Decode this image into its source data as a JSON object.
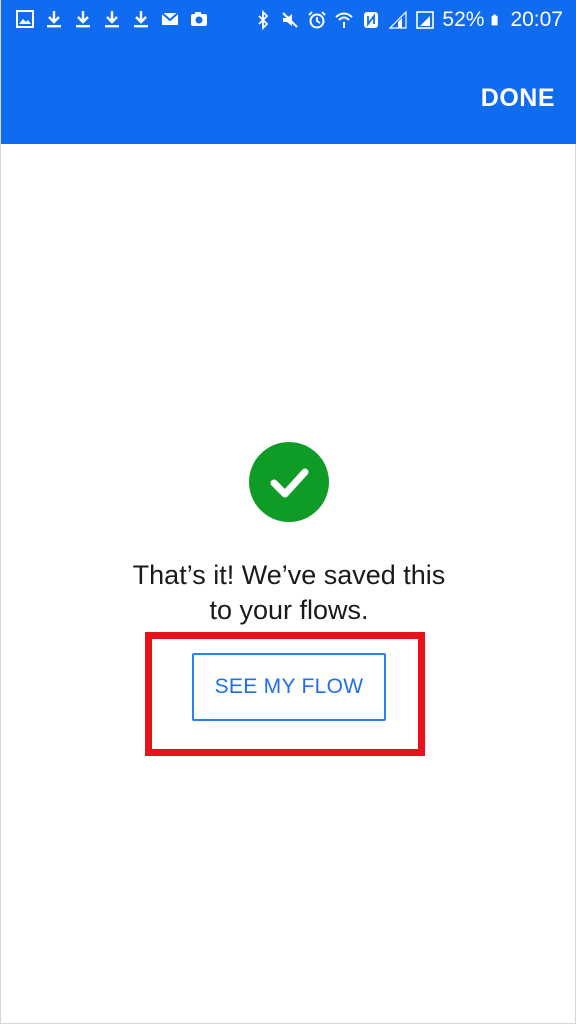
{
  "status_bar": {
    "left_icons": [
      "image-icon",
      "download-icon",
      "download-icon",
      "download-icon",
      "download-icon",
      "email-icon",
      "photo-icon"
    ],
    "right_icons": [
      "bluetooth-icon",
      "mute-icon",
      "alarm-icon",
      "wifi-icon",
      "nfc-icon",
      "signal-icon",
      "signal-icon"
    ],
    "battery": "52%",
    "time": "20:07"
  },
  "header": {
    "done_label": "DONE",
    "background_color": "#0f6cf0"
  },
  "main": {
    "success_icon": "check-icon",
    "success_color": "#0e9c26",
    "message_line1": "That’s it! We’ve saved this",
    "message_line2": "to your flows.",
    "see_flow_label": "SEE MY FLOW",
    "highlight_color": "#e8121b"
  }
}
